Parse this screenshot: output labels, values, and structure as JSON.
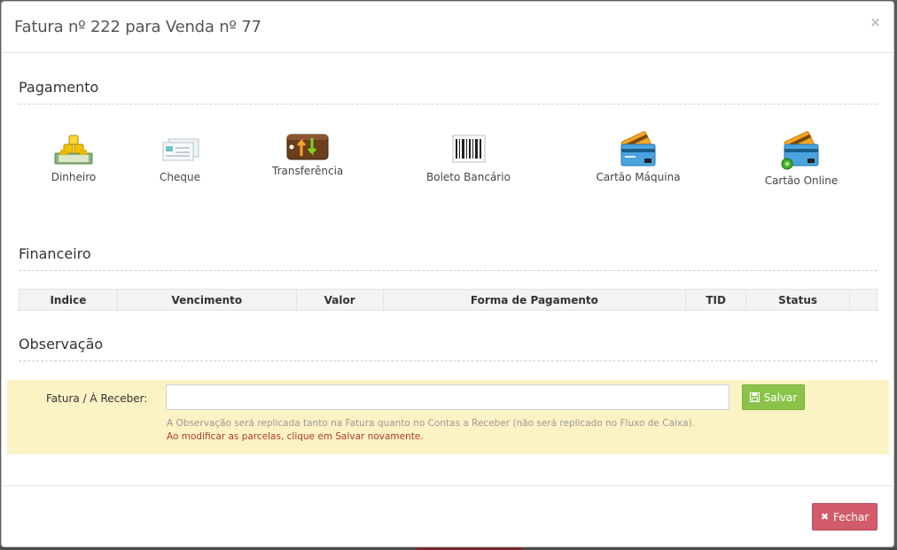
{
  "modal": {
    "title": "Fatura nº 222 para Venda nº 77",
    "close_glyph": "×"
  },
  "pagamento": {
    "title": "Pagamento",
    "methods": [
      {
        "label": "Dinheiro",
        "icon": "money-stack-icon"
      },
      {
        "label": "Cheque",
        "icon": "check-icon"
      },
      {
        "label": "Transferência",
        "icon": "transfer-icon"
      },
      {
        "label": "Boleto Bancário",
        "icon": "barcode-icon"
      },
      {
        "label": "Cartão Máquina",
        "icon": "card-machine-icon"
      },
      {
        "label": "Cartão Online",
        "icon": "card-online-icon"
      }
    ]
  },
  "financeiro": {
    "title": "Financeiro",
    "columns": [
      "Indice",
      "Vencimento",
      "Valor",
      "Forma de Pagamento",
      "TID",
      "Status",
      ""
    ]
  },
  "observacao": {
    "title": "Observação",
    "label": "Fatura / À Receber:",
    "value": "",
    "placeholder": "",
    "save_label": "Salvar",
    "help_text": "A Observação será replicada tanto na Fatura quanto no Contas a Receber (não será replicado no Fluxo de Caixa).",
    "warning_text": "Ao modificar as parcelas, clique em Salvar novamente."
  },
  "footer": {
    "close_label": "Fechar"
  },
  "colors": {
    "save_button": "#8bc34a",
    "close_button": "#d15b6b",
    "obs_panel": "#fbf3c4",
    "warning_text": "#b03a2e"
  }
}
